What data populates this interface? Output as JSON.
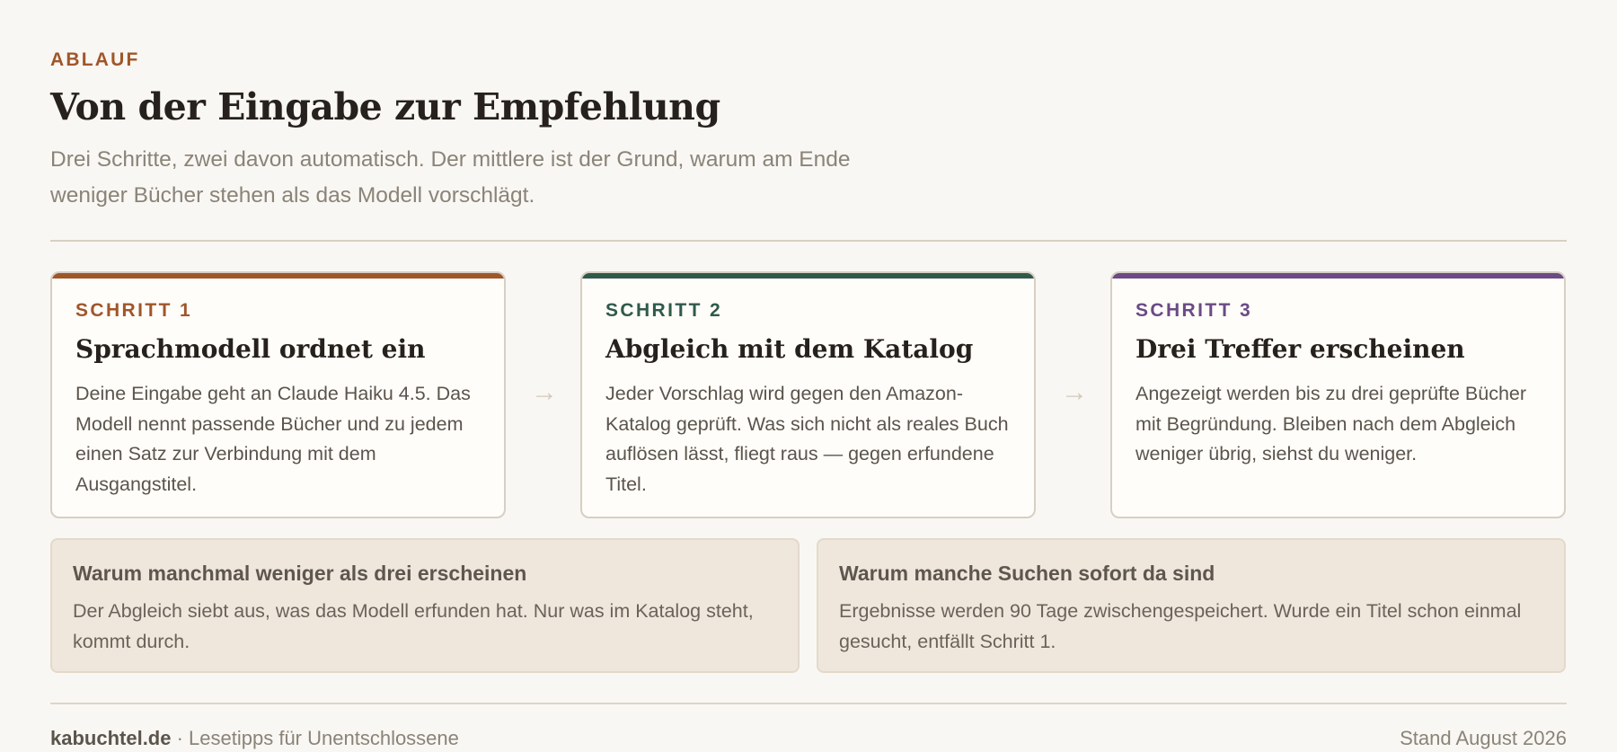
{
  "header": {
    "eyebrow": "ABLAUF",
    "title": "Von der Eingabe zur Empfehlung",
    "subtitle": "Drei Schritte, zwei davon automatisch. Der mittlere ist der Grund, warum am Ende weniger Bücher stehen als das Modell vorschlägt."
  },
  "steps": [
    {
      "label": "SCHRITT 1",
      "title": "Sprachmodell ordnet ein",
      "text": "Deine Eingabe geht an Claude Haiku 4.5. Das Modell nennt passende Bücher und zu jedem einen Satz zur Verbindung mit dem Ausgangstitel.",
      "accent": "#a0562a"
    },
    {
      "label": "SCHRITT 2",
      "title": "Abgleich mit dem Katalog",
      "text": "Jeder Vorschlag wird gegen den Amazon-Katalog geprüft. Was sich nicht als reales Buch auflösen lässt, fliegt raus — gegen erfundene Titel.",
      "accent": "#2f5a4b"
    },
    {
      "label": "SCHRITT 3",
      "title": "Drei Treffer erscheinen",
      "text": "Angezeigt werden bis zu drei geprüfte Bücher mit Begründung. Bleiben nach dem Abgleich weniger übrig, siehst du weniger.",
      "accent": "#6b4a85"
    }
  ],
  "arrow_glyph": "→",
  "notes": [
    {
      "title": "Warum manchmal weniger als drei erscheinen",
      "text": "Der Abgleich siebt aus, was das Modell erfunden hat. Nur was im Katalog steht, kommt durch."
    },
    {
      "title": "Warum manche Suchen sofort da sind",
      "text": "Ergebnisse werden 90 Tage zwischengespeichert. Wurde ein Titel schon einmal gesucht, entfällt Schritt 1."
    }
  ],
  "footer": {
    "brand": "kabuchtel.de",
    "separator": " · ",
    "tagline": "Lesetipps für Unentschlossene",
    "stamp": "Stand August 2026"
  }
}
